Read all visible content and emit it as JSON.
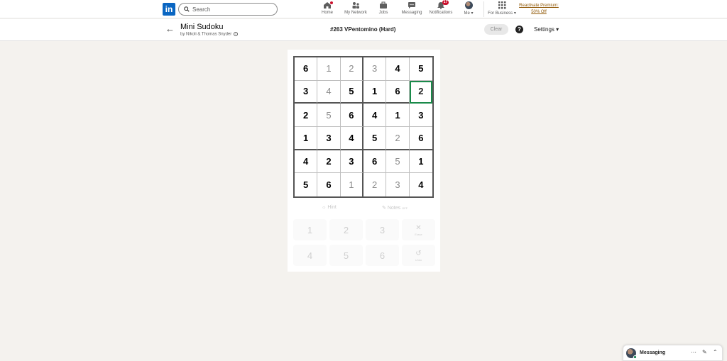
{
  "nav": {
    "search_placeholder": "Search",
    "items": [
      {
        "label": "Home",
        "icon": "home-icon"
      },
      {
        "label": "My Network",
        "icon": "network-icon"
      },
      {
        "label": "Jobs",
        "icon": "briefcase-icon"
      },
      {
        "label": "Messaging",
        "icon": "chat-icon"
      },
      {
        "label": "Notifications",
        "icon": "bell-icon",
        "badge": "17"
      },
      {
        "label": "Me",
        "icon": "avatar"
      }
    ],
    "business_label": "For Business",
    "premium_line1": "Reactivate Premium:",
    "premium_line2": "50% Off"
  },
  "game": {
    "title": "Mini Sudoku",
    "author": "by Nikoli & Thomas Snyder",
    "puzzle_name": "#263 VPentomino (Hard)",
    "clear_label": "Clear",
    "help_label": "?",
    "settings_label": "Settings"
  },
  "board": {
    "rows": [
      [
        {
          "v": "6",
          "t": "given"
        },
        {
          "v": "1",
          "t": "filled"
        },
        {
          "v": "2",
          "t": "filled"
        },
        {
          "v": "3",
          "t": "filled"
        },
        {
          "v": "4",
          "t": "given"
        },
        {
          "v": "5",
          "t": "given"
        }
      ],
      [
        {
          "v": "3",
          "t": "given"
        },
        {
          "v": "4",
          "t": "filled"
        },
        {
          "v": "5",
          "t": "given"
        },
        {
          "v": "1",
          "t": "given"
        },
        {
          "v": "6",
          "t": "given"
        },
        {
          "v": "2",
          "t": "selected"
        }
      ],
      [
        {
          "v": "2",
          "t": "given"
        },
        {
          "v": "5",
          "t": "filled"
        },
        {
          "v": "6",
          "t": "given"
        },
        {
          "v": "4",
          "t": "given"
        },
        {
          "v": "1",
          "t": "given"
        },
        {
          "v": "3",
          "t": "given"
        }
      ],
      [
        {
          "v": "1",
          "t": "given"
        },
        {
          "v": "3",
          "t": "given"
        },
        {
          "v": "4",
          "t": "given"
        },
        {
          "v": "5",
          "t": "given"
        },
        {
          "v": "2",
          "t": "filled"
        },
        {
          "v": "6",
          "t": "given"
        }
      ],
      [
        {
          "v": "4",
          "t": "given"
        },
        {
          "v": "2",
          "t": "given"
        },
        {
          "v": "3",
          "t": "given"
        },
        {
          "v": "6",
          "t": "given"
        },
        {
          "v": "5",
          "t": "filled"
        },
        {
          "v": "1",
          "t": "given"
        }
      ],
      [
        {
          "v": "5",
          "t": "given"
        },
        {
          "v": "6",
          "t": "given"
        },
        {
          "v": "1",
          "t": "filled"
        },
        {
          "v": "2",
          "t": "filled"
        },
        {
          "v": "3",
          "t": "filled"
        },
        {
          "v": "4",
          "t": "given"
        }
      ]
    ],
    "selected_color": "#1a8a4a"
  },
  "tools": {
    "hint_label": "Hint",
    "notes_label": "Notes",
    "notes_state": "OFF"
  },
  "keypad": {
    "keys": [
      "1",
      "2",
      "3",
      "4",
      "5",
      "6"
    ],
    "erase_label": "Erase",
    "undo_label": "Undo"
  },
  "messaging": {
    "label": "Messaging"
  }
}
